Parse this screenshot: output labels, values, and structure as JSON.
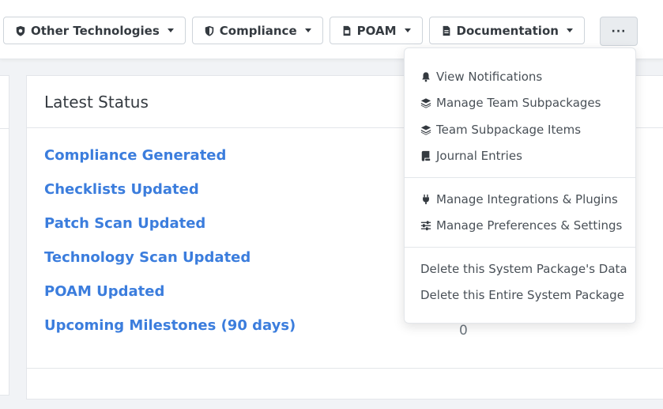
{
  "toolbar": {
    "buttons": [
      {
        "label": "Other Technologies",
        "icon": "shield-icon"
      },
      {
        "label": "Compliance",
        "icon": "shield-half-icon"
      },
      {
        "label": "POAM",
        "icon": "file-pdf-icon"
      },
      {
        "label": "Documentation",
        "icon": "file-text-icon"
      }
    ],
    "more_label": "···"
  },
  "status_card": {
    "title": "Latest Status",
    "items": [
      {
        "label": "Compliance Generated"
      },
      {
        "label": "Checklists Updated"
      },
      {
        "label": "Patch Scan Updated"
      },
      {
        "label": "Technology Scan Updated"
      },
      {
        "label": "POAM Updated"
      },
      {
        "label": "Upcoming Milestones (90 days)",
        "value": "0"
      }
    ]
  },
  "dropdown": {
    "group1": [
      {
        "label": "View Notifications",
        "icon": "bell-icon"
      },
      {
        "label": "Manage Team Subpackages",
        "icon": "layers-icon"
      },
      {
        "label": "Team Subpackage Items",
        "icon": "layers-icon"
      },
      {
        "label": "Journal Entries",
        "icon": "scroll-icon"
      }
    ],
    "group2": [
      {
        "label": "Manage Integrations & Plugins",
        "icon": "plug-icon"
      },
      {
        "label": "Manage Preferences & Settings",
        "icon": "sliders-icon"
      }
    ],
    "group3": [
      {
        "label": "Delete this System Package's Data"
      },
      {
        "label": "Delete this Entire System Package"
      }
    ]
  },
  "colors": {
    "link": "#3b7ddd",
    "text": "#343a40",
    "muted": "#6c757d"
  }
}
